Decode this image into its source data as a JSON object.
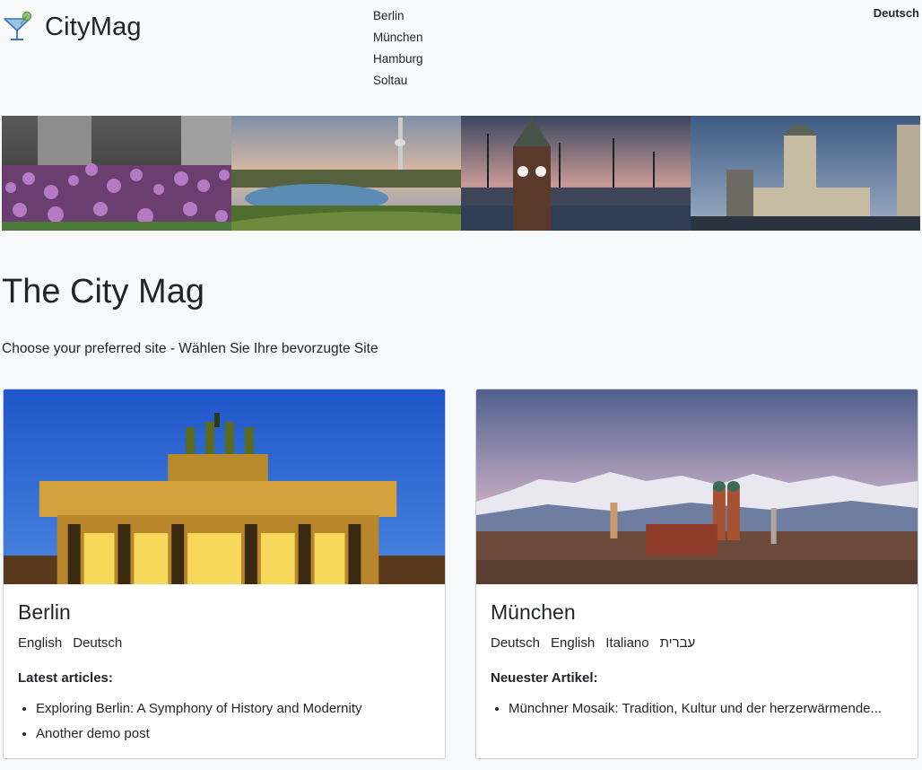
{
  "header": {
    "brand": "CityMag",
    "nav": [
      "Berlin",
      "München",
      "Hamburg",
      "Soltau"
    ],
    "language": "Deutsch"
  },
  "main": {
    "title": "The City Mag",
    "subtitle": "Choose your preferred site - Wählen Sie Ihre bevorzugte Site"
  },
  "cards": [
    {
      "title": "Berlin",
      "languages": [
        "English",
        "Deutsch"
      ],
      "articles_heading": "Latest articles:",
      "articles": [
        "Exploring Berlin: A Symphony of History and Modernity",
        "Another demo post"
      ]
    },
    {
      "title": "München",
      "languages": [
        "Deutsch",
        "English",
        "Italiano",
        "עברית"
      ],
      "articles_heading": "Neuester Artikel:",
      "articles": [
        "Münchner Mosaik: Tradition, Kultur und der herzerwärmende..."
      ]
    }
  ],
  "colors": {
    "background": "#f8f9fa",
    "text": "#212529",
    "card_border": "#c9ced3"
  }
}
